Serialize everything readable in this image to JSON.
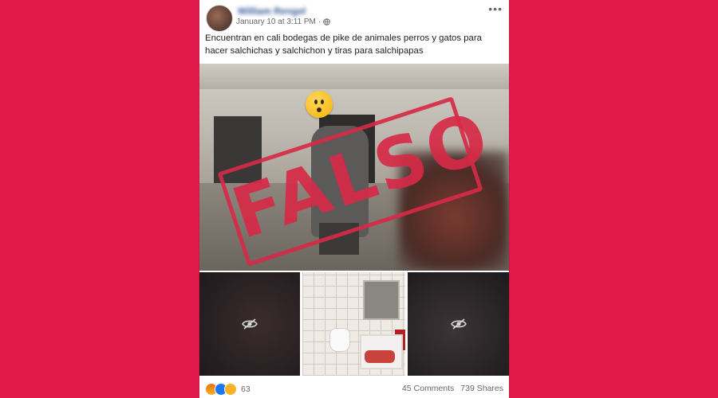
{
  "post": {
    "author": "William Rengel",
    "timestamp": "January 10 at 3:11 PM",
    "separator": "·",
    "text": "Encuentran en cali bodegas de pike de animales perros y gatos para hacer salchichas y salchichon y tiras para salchipapas",
    "more_label": "•••"
  },
  "photo": {
    "stamp": "FALSO"
  },
  "reactions": {
    "icons": [
      "angry-icon",
      "like-icon",
      "wow-icon"
    ],
    "count": "63"
  },
  "stats": {
    "comments": "45 Comments",
    "shares": "739 Shares"
  },
  "colors": {
    "background": "#e0194a",
    "stamp": "#d62947",
    "link": "#385898"
  }
}
